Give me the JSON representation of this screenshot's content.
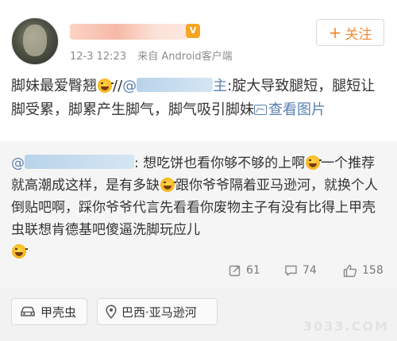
{
  "header": {
    "time": "12-3 12:23",
    "source": "来自 Android客户端",
    "follow_label": "关注"
  },
  "post": {
    "text_start": "脚妹最爱臀翘",
    "text_sep": "//",
    "mention_visible_part": "@",
    "mention_tail": "主",
    "text_rest": ":腚大导致腿短，腿短让脚受累，脚累产生脚气，脚气吸引脚妹",
    "link_label": "查看图片"
  },
  "repost": {
    "mention_prefix": "@",
    "mention_tail": "",
    "text_part1": ": 想吃饼也看你够不够的上啊",
    "text_part2": "一个推荐就高潮成这样，是有多缺",
    "text_part3": "跟你爷爷隔着亚马逊河，就换个人倒贴吧啊，踩你爷爷代言先看看你废物主子有没有比得上甲壳虫联想肯德基吧傻逼洗脚玩应儿"
  },
  "actions": {
    "repost_count": "61",
    "comment_count": "74",
    "like_count": "158"
  },
  "footer": {
    "car_label": "甲壳虫",
    "place_label": "巴西·亚马逊河"
  },
  "watermark": "3033.COM",
  "colors": {
    "accent": "#f18a36",
    "link": "#5a7fb0",
    "meta": "#8c8c8c"
  },
  "icons": [
    "avatar",
    "vip-badge-icon",
    "plus-icon",
    "laugh-emoji-icon",
    "image-link-icon",
    "repost-icon",
    "comment-icon",
    "like-icon",
    "car-icon",
    "location-pin-icon"
  ]
}
